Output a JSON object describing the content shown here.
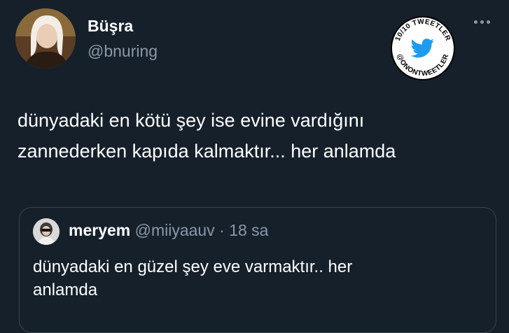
{
  "tweet": {
    "display_name": "Büşra",
    "handle": "@bnuring",
    "text_line1": "dünyadaki en kötü şey ise evine vardığını",
    "text_line2": "zannederken kapıda kalmaktır... her anlamda"
  },
  "watermark": {
    "top_text": "10/10 TWEETLER",
    "bottom_text": "@ONONTWEETLER",
    "icon": "twitter-bird-icon",
    "colors": {
      "ring": "#000000",
      "bird": "#1d9bf0",
      "background": "#ffffff"
    }
  },
  "quoted": {
    "display_name": "meryem",
    "handle": "@miiyaauv",
    "separator": "·",
    "time": "18 sa",
    "text_line1": "dünyadaki en güzel şey eve varmaktır.. her",
    "text_line2": "anlamda"
  },
  "icons": {
    "more": "more-horizontal-icon"
  },
  "colors": {
    "background": "#15202b",
    "primary_text": "#ffffff",
    "secondary_text": "#8b98a5",
    "border": "#38444d"
  }
}
